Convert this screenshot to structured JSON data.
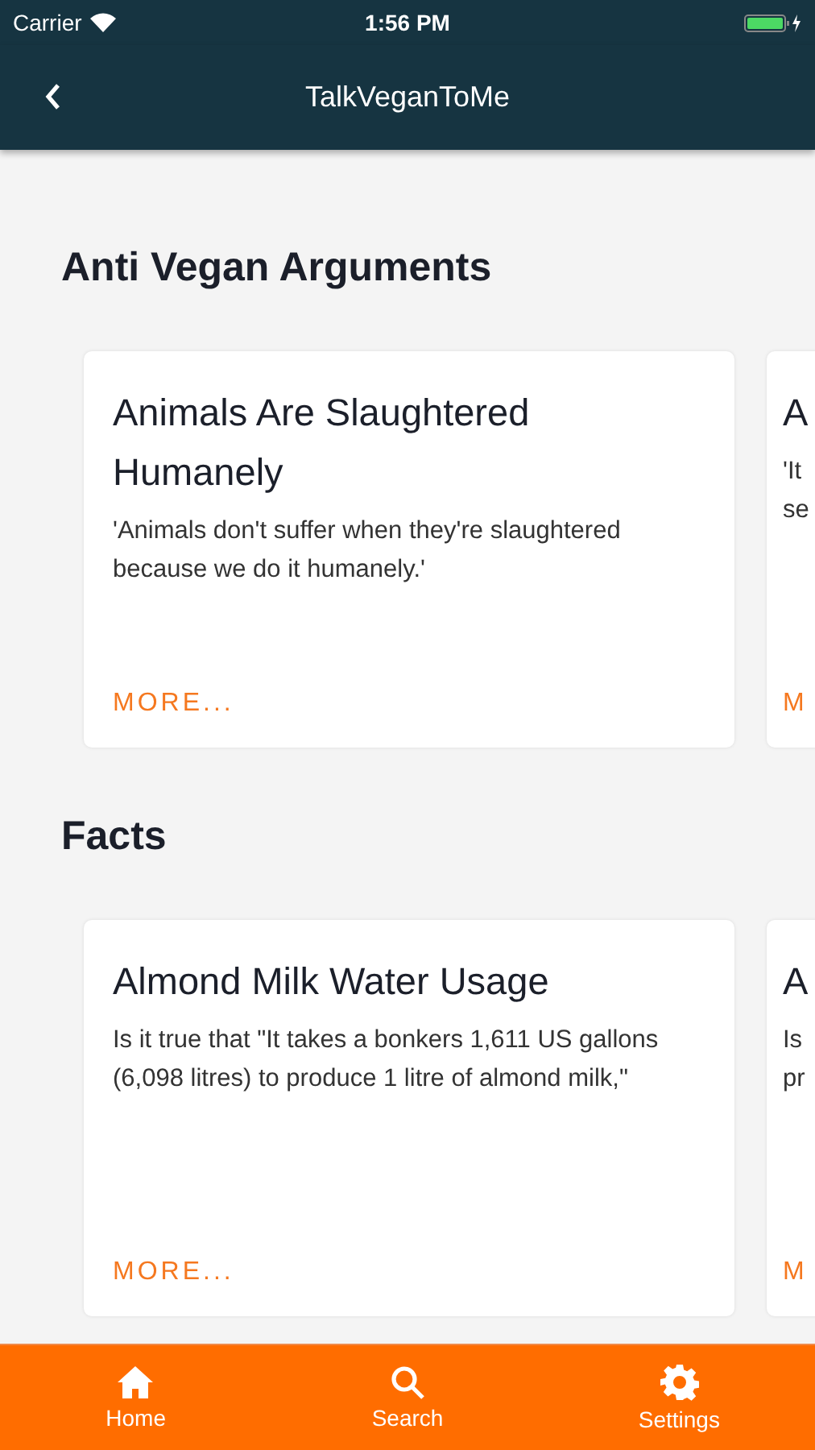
{
  "status_bar": {
    "carrier": "Carrier",
    "time": "1:56 PM"
  },
  "nav_bar": {
    "title": "TalkVeganToMe"
  },
  "sections": [
    {
      "title": "Anti Vegan Arguments",
      "cards": [
        {
          "kind": "full",
          "title": "Animals Are Slaughtered Humanely",
          "description": "'Animals don't suffer when they're slaughtered because we do it humanely.'",
          "more": "MORE..."
        },
        {
          "kind": "partial",
          "title": "A",
          "description_lines": [
            "'It",
            "se"
          ],
          "more": "M"
        }
      ]
    },
    {
      "title": "Facts",
      "cards": [
        {
          "kind": "full",
          "title": "Almond Milk Water Usage",
          "description": "Is it true that \"It takes a bonkers 1,611 US gallons (6,098 litres) to produce 1 litre of almond milk,\"",
          "more": "MORE..."
        },
        {
          "kind": "partial",
          "title": "A",
          "description_lines": [
            "Is",
            "pr"
          ],
          "more": "M"
        }
      ]
    }
  ],
  "tab_bar": [
    {
      "kind": "home",
      "label": "Home"
    },
    {
      "kind": "search",
      "label": "Search"
    },
    {
      "kind": "settings",
      "label": "Settings"
    }
  ]
}
